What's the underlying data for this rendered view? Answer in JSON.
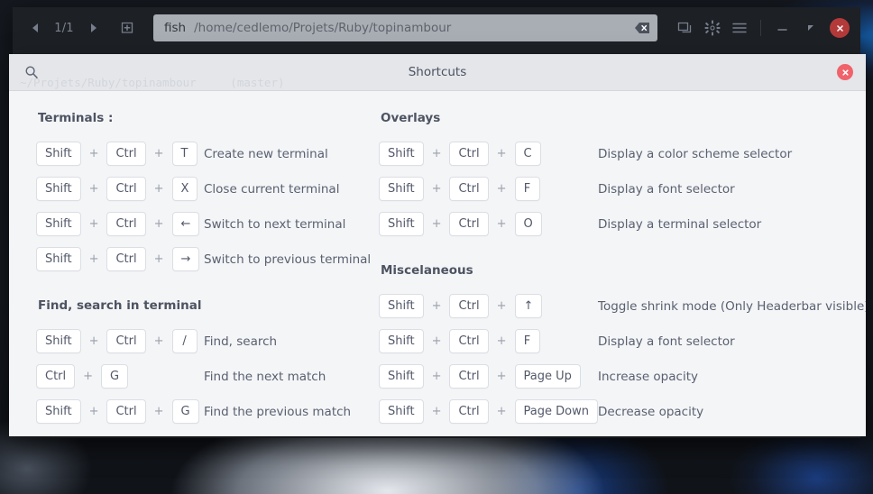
{
  "window": {
    "nav": {
      "prev_icon": "chevron-left-icon",
      "next_icon": "chevron-right-icon",
      "page_indicator": "1/1"
    },
    "new_terminal_icon": "add-terminal-icon",
    "entry": {
      "shell": "fish",
      "path": "/home/cedlemo/Projets/Ruby/topinambour",
      "clear_icon": "backspace-icon"
    },
    "actions": [
      {
        "name": "terminals-overview-button",
        "icon": "windows-icon"
      },
      {
        "name": "preferences-button",
        "icon": "gear-icon"
      },
      {
        "name": "menu-button",
        "icon": "hamburger-menu-icon"
      }
    ],
    "controls": [
      {
        "name": "minimize-button",
        "icon": "minimize-icon"
      },
      {
        "name": "maximize-button",
        "icon": "maximize-icon"
      },
      {
        "name": "close-button",
        "icon": "close-icon"
      }
    ],
    "terminal_text": "~/Projets/Ruby/topinambour",
    "terminal_branch": "(master)"
  },
  "dialog": {
    "title": "Shortcuts",
    "search_icon": "search-icon",
    "close_icon": "close-icon",
    "ghost_text": "~/Projets/Ruby/topinambour     (master)",
    "columns": [
      {
        "name": "left",
        "groups": [
          {
            "title": "Terminals :",
            "rows": [
              {
                "keys": [
                  "Shift",
                  "Ctrl",
                  "T"
                ],
                "description": "Create new terminal"
              },
              {
                "keys": [
                  "Shift",
                  "Ctrl",
                  "X"
                ],
                "description": "Close current terminal"
              },
              {
                "keys": [
                  "Shift",
                  "Ctrl",
                  "←"
                ],
                "description": "Switch to next terminal"
              },
              {
                "keys": [
                  "Shift",
                  "Ctrl",
                  "→"
                ],
                "description": "Switch to previous terminal"
              }
            ]
          },
          {
            "title": "Find, search in terminal",
            "rows": [
              {
                "keys": [
                  "Shift",
                  "Ctrl",
                  "/"
                ],
                "description": "Find, search"
              },
              {
                "keys": [
                  "Ctrl",
                  "G"
                ],
                "description": "Find the next match"
              },
              {
                "keys": [
                  "Shift",
                  "Ctrl",
                  "G"
                ],
                "description": "Find the previous match"
              }
            ]
          }
        ]
      },
      {
        "name": "right",
        "groups": [
          {
            "title": "Overlays",
            "rows": [
              {
                "keys": [
                  "Shift",
                  "Ctrl",
                  "C"
                ],
                "description": "Display a color scheme selector"
              },
              {
                "keys": [
                  "Shift",
                  "Ctrl",
                  "F"
                ],
                "description": "Display a font selector"
              },
              {
                "keys": [
                  "Shift",
                  "Ctrl",
                  "O"
                ],
                "description": "Display a terminal selector"
              }
            ]
          },
          {
            "title": "Miscelaneous",
            "rows": [
              {
                "keys": [
                  "Shift",
                  "Ctrl",
                  "↑"
                ],
                "description": "Toggle shrink mode (Only Headerbar visible)"
              },
              {
                "keys": [
                  "Shift",
                  "Ctrl",
                  "F"
                ],
                "description": "Display a font selector"
              },
              {
                "keys": [
                  "Shift",
                  "Ctrl",
                  "Page Up"
                ],
                "description": "Increase opacity"
              },
              {
                "keys": [
                  "Shift",
                  "Ctrl",
                  "Page Down"
                ],
                "description": "Decrease opacity"
              }
            ]
          }
        ]
      }
    ]
  },
  "colors": {
    "dialog_bg": "#f4f5f7",
    "header_bg": "#1d2025",
    "key_bg": "#ffffff",
    "accent_close": "#f0636b",
    "wm_close": "#b43a3a"
  }
}
